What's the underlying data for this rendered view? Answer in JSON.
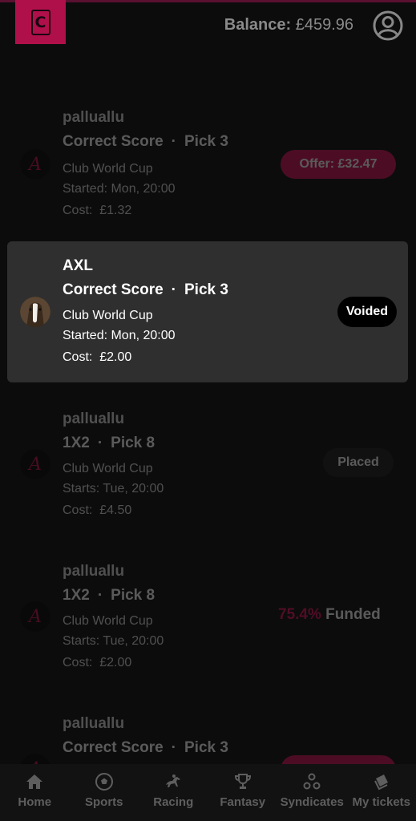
{
  "header": {
    "logo_letter": "C",
    "balance_label": "Balance:",
    "balance_value": "£459.96",
    "account_icon": "account-circle-icon",
    "accent_color": "#b0104a"
  },
  "tickets": [
    {
      "user": "palluallu",
      "game": "Correct Score",
      "pick": "Pick 3",
      "competition": "Club World Cup",
      "time": "Started: Mon, 20:00",
      "cost_label": "Cost:",
      "cost": "£1.32",
      "status_type": "offer",
      "status": "Offer: £32.47",
      "avatar": "a-logo-icon",
      "active": false
    },
    {
      "user": "AXL",
      "game": "Correct Score",
      "pick": "Pick 3",
      "competition": "Club World Cup",
      "time": "Started: Mon, 20:00",
      "cost_label": "Cost:",
      "cost": "£2.00",
      "status_type": "voided",
      "status": "Voided",
      "avatar": "horse-photo",
      "active": true
    },
    {
      "user": "palluallu",
      "game": "1X2",
      "pick": "Pick 8",
      "competition": "Club World Cup",
      "time": "Starts: Tue, 20:00",
      "cost_label": "Cost:",
      "cost": "£4.50",
      "status_type": "placed",
      "status": "Placed",
      "avatar": "a-logo-icon",
      "active": false
    },
    {
      "user": "palluallu",
      "game": "1X2",
      "pick": "Pick 8",
      "competition": "Club World Cup",
      "time": "Starts: Tue, 20:00",
      "cost_label": "Cost:",
      "cost": "£2.00",
      "status_type": "funded",
      "status_pct": "75.4%",
      "status": "Funded",
      "avatar": "a-logo-icon",
      "active": false
    },
    {
      "user": "palluallu",
      "game": "Correct Score",
      "pick": "Pick 3",
      "status_type": "offer",
      "avatar": "a-logo-icon",
      "active": false
    }
  ],
  "nav": [
    {
      "label": "Home",
      "icon": "home-icon"
    },
    {
      "label": "Sports",
      "icon": "soccer-ball-icon"
    },
    {
      "label": "Racing",
      "icon": "horse-racing-icon"
    },
    {
      "label": "Fantasy",
      "icon": "trophy-icon"
    },
    {
      "label": "Syndicates",
      "icon": "syndicates-icon"
    },
    {
      "label": "My tickets",
      "icon": "ticket-icon"
    }
  ]
}
